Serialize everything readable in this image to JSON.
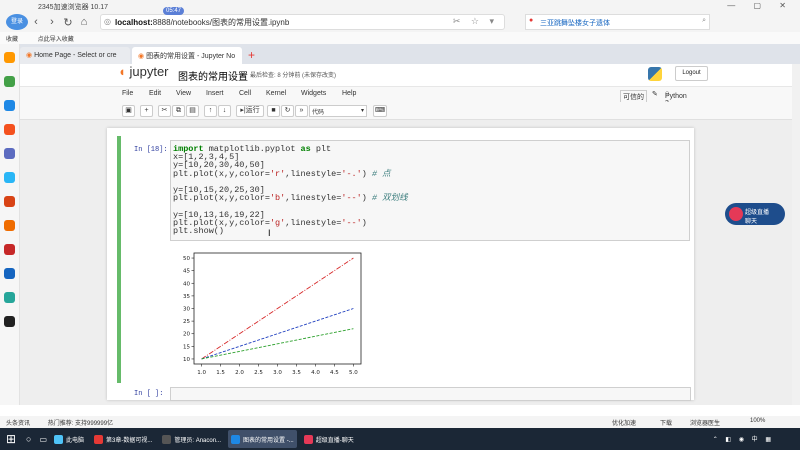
{
  "browser": {
    "app_title": "2345加速浏览器 10.17",
    "login_label": "登录",
    "url_host": "localhost:",
    "url_path": "8888/notebooks/图表的常用设置.ipynb",
    "url_badge": "05:47",
    "search_text": "三亚跳舞坠楼女子遗体",
    "bookmarks": [
      "收藏",
      "点此导入收藏"
    ],
    "tabs": [
      "Home Page - Select or cre",
      "图表的常用设置 - Jupyter No"
    ]
  },
  "jupyter": {
    "logo_text": "jupyter",
    "notebook_title": "图表的常用设置",
    "checkpoint": "最后检查: 8 分钟前 (未保存改变)",
    "logout_label": "Logout",
    "menu": [
      "File",
      "Edit",
      "View",
      "Insert",
      "Cell",
      "Kernel",
      "Widgets",
      "Help"
    ],
    "trusted": "可信的",
    "kernel": "Python 3",
    "run_label": "运行",
    "cell_type": "代码"
  },
  "cell": {
    "prompt": "In  [18]:",
    "code": [
      "import matplotlib.pyplot as plt",
      "x=[1,2,3,4,5]",
      "y=[10,20,30,40,50]",
      "plt.plot(x,y,color='r',linestyle='-.') # 点",
      "",
      "y=[10,15,20,25,30]",
      "plt.plot(x,y,color='b',linestyle='--') # 双划线",
      "",
      "y=[10,13,16,19,22]",
      "plt.plot(x,y,color='g',linestyle='--')",
      "plt.show()"
    ],
    "next_prompt": "In  [ ]:"
  },
  "chart_data": {
    "type": "line",
    "x": [
      1,
      2,
      3,
      4,
      5
    ],
    "series": [
      {
        "values": [
          10,
          20,
          30,
          40,
          50
        ],
        "color": "#d62728",
        "style": "dashdot"
      },
      {
        "values": [
          10,
          15,
          20,
          25,
          30
        ],
        "color": "#1f3fbf",
        "style": "dashed"
      },
      {
        "values": [
          10,
          13,
          16,
          19,
          22
        ],
        "color": "#2ca02c",
        "style": "dashed"
      }
    ],
    "xticks": [
      "1.0",
      "1.5",
      "2.0",
      "2.5",
      "3.0",
      "3.5",
      "4.0",
      "4.5",
      "5.0"
    ],
    "yticks": [
      "10",
      "15",
      "20",
      "25",
      "30",
      "35",
      "40",
      "45",
      "50"
    ],
    "xlim": [
      0.8,
      5.2
    ],
    "ylim": [
      8,
      52
    ],
    "title": "",
    "xlabel": "",
    "ylabel": ""
  },
  "overlay": {
    "live_label": "超级直播",
    "live_sub": "聊天"
  },
  "statusbar": {
    "left": "头条资讯",
    "news": "热门推荐: 支持999999亿",
    "right": [
      "优化加速",
      "下载",
      "浏览器医生",
      "100%"
    ]
  },
  "taskbar": {
    "items": [
      {
        "label": "此电脑",
        "color": "#4fc3f7"
      },
      {
        "label": "第3章-数据可视...",
        "color": "#e53935"
      },
      {
        "label": "管理员: Anacon...",
        "color": "#555"
      },
      {
        "label": "图表的常用设置 -...",
        "color": "#1e88e5"
      },
      {
        "label": "超级直播-聊天",
        "color": "#e53957"
      }
    ],
    "tray": "⌃ ◧ ◉ 中 ▦"
  },
  "colors": {
    "accent": "#f37626",
    "select_bar": "#66bb6a",
    "prompt": "#303f9f"
  }
}
